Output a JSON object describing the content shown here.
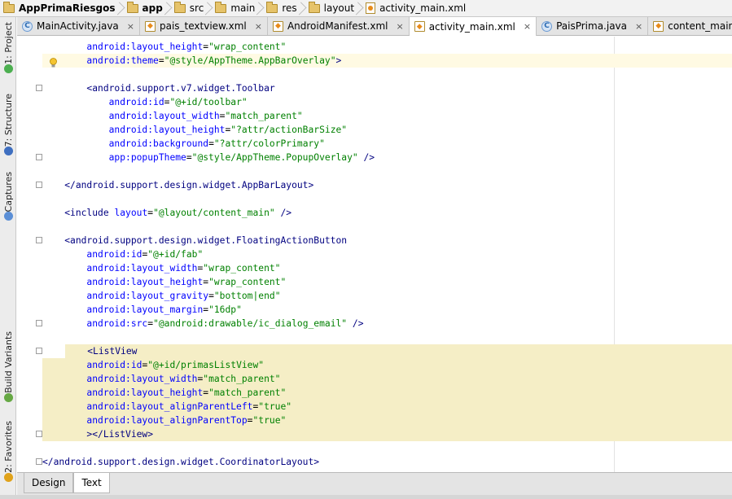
{
  "breadcrumb": [
    {
      "label": "AppPrimaRiesgos",
      "icon": "folder-icon",
      "bold": true
    },
    {
      "label": "app",
      "icon": "folder-icon",
      "bold": true
    },
    {
      "label": "src",
      "icon": "folder-icon",
      "bold": false
    },
    {
      "label": "main",
      "icon": "folder-icon",
      "bold": false
    },
    {
      "label": "res",
      "icon": "folder-icon",
      "bold": false
    },
    {
      "label": "layout",
      "icon": "folder-icon",
      "bold": false
    },
    {
      "label": "activity_main.xml",
      "icon": "xml-file-icon",
      "bold": false
    }
  ],
  "side_tools": [
    "1: Project",
    "7: Structure",
    "Captures",
    "Build Variants",
    "2: Favorites"
  ],
  "tabs": [
    {
      "label": "MainActivity.java",
      "type": "java",
      "active": false
    },
    {
      "label": "pais_textview.xml",
      "type": "xml",
      "active": false
    },
    {
      "label": "AndroidManifest.xml",
      "type": "xml",
      "active": false
    },
    {
      "label": "activity_main.xml",
      "type": "xml",
      "active": true
    },
    {
      "label": "PaisPrima.java",
      "type": "java",
      "active": false
    },
    {
      "label": "content_main.xml",
      "type": "xml",
      "active": false
    }
  ],
  "tab_close_glyph": "×",
  "code_lines": [
    {
      "indent": "        ",
      "segs": [
        [
          "attr",
          "android:layout_height"
        ],
        [
          "plain",
          "="
        ],
        [
          "val",
          "\"wrap_content\""
        ]
      ]
    },
    {
      "indent": "        ",
      "segs": [
        [
          "attr",
          "android:theme"
        ],
        [
          "plain",
          "="
        ],
        [
          "val",
          "\"@style/AppTheme.AppBarOverlay\""
        ],
        [
          "tag",
          ">"
        ]
      ],
      "cur": true,
      "bulb": true
    },
    {
      "indent": "",
      "segs": []
    },
    {
      "indent": "        ",
      "segs": [
        [
          "tag",
          "<android.support.v7.widget.Toolbar"
        ]
      ],
      "fold": true
    },
    {
      "indent": "            ",
      "segs": [
        [
          "attr",
          "android:id"
        ],
        [
          "plain",
          "="
        ],
        [
          "val",
          "\"@+id/toolbar\""
        ]
      ]
    },
    {
      "indent": "            ",
      "segs": [
        [
          "attr",
          "android:layout_width"
        ],
        [
          "plain",
          "="
        ],
        [
          "val",
          "\"match_parent\""
        ]
      ]
    },
    {
      "indent": "            ",
      "segs": [
        [
          "attr",
          "android:layout_height"
        ],
        [
          "plain",
          "="
        ],
        [
          "val",
          "\"?attr/actionBarSize\""
        ]
      ]
    },
    {
      "indent": "            ",
      "segs": [
        [
          "attr",
          "android:background"
        ],
        [
          "plain",
          "="
        ],
        [
          "val",
          "\"?attr/colorPrimary\""
        ]
      ]
    },
    {
      "indent": "            ",
      "segs": [
        [
          "attr",
          "app:popupTheme"
        ],
        [
          "plain",
          "="
        ],
        [
          "val",
          "\"@style/AppTheme.PopupOverlay\""
        ],
        [
          "tag",
          " />"
        ]
      ],
      "fold": true
    },
    {
      "indent": "",
      "segs": []
    },
    {
      "indent": "    ",
      "segs": [
        [
          "tag",
          "</android.support.design.widget.AppBarLayout>"
        ]
      ],
      "fold": true
    },
    {
      "indent": "",
      "segs": []
    },
    {
      "indent": "    ",
      "segs": [
        [
          "tag",
          "<include "
        ],
        [
          "attr",
          "layout"
        ],
        [
          "plain",
          "="
        ],
        [
          "val",
          "\"@layout/content_main\""
        ],
        [
          "tag",
          " />"
        ]
      ]
    },
    {
      "indent": "",
      "segs": []
    },
    {
      "indent": "    ",
      "segs": [
        [
          "tag",
          "<android.support.design.widget.FloatingActionButton"
        ]
      ],
      "fold": true
    },
    {
      "indent": "        ",
      "segs": [
        [
          "attr",
          "android:id"
        ],
        [
          "plain",
          "="
        ],
        [
          "val",
          "\"@+id/fab\""
        ]
      ]
    },
    {
      "indent": "        ",
      "segs": [
        [
          "attr",
          "android:layout_width"
        ],
        [
          "plain",
          "="
        ],
        [
          "val",
          "\"wrap_content\""
        ]
      ]
    },
    {
      "indent": "        ",
      "segs": [
        [
          "attr",
          "android:layout_height"
        ],
        [
          "plain",
          "="
        ],
        [
          "val",
          "\"wrap_content\""
        ]
      ]
    },
    {
      "indent": "        ",
      "segs": [
        [
          "attr",
          "android:layout_gravity"
        ],
        [
          "plain",
          "="
        ],
        [
          "val",
          "\"bottom|end\""
        ]
      ]
    },
    {
      "indent": "        ",
      "segs": [
        [
          "attr",
          "android:layout_margin"
        ],
        [
          "plain",
          "="
        ],
        [
          "val",
          "\"16dp\""
        ]
      ]
    },
    {
      "indent": "        ",
      "segs": [
        [
          "attr",
          "android:src"
        ],
        [
          "plain",
          "="
        ],
        [
          "val",
          "\"@android:drawable/ic_dialog_email\""
        ],
        [
          "tag",
          " />"
        ]
      ],
      "fold": true
    },
    {
      "indent": "",
      "segs": []
    },
    {
      "indent": "    ",
      "segs": [
        [
          "tag",
          "<ListView"
        ]
      ],
      "fold": true,
      "hl": true
    },
    {
      "indent": "        ",
      "segs": [
        [
          "attr",
          "android:id"
        ],
        [
          "plain",
          "="
        ],
        [
          "val",
          "\"@+id/primasListView\""
        ]
      ],
      "hl": true
    },
    {
      "indent": "        ",
      "segs": [
        [
          "attr",
          "android:layout_width"
        ],
        [
          "plain",
          "="
        ],
        [
          "val",
          "\"match_parent\""
        ]
      ],
      "hl": true
    },
    {
      "indent": "        ",
      "segs": [
        [
          "attr",
          "android:layout_height"
        ],
        [
          "plain",
          "="
        ],
        [
          "val",
          "\"match_parent\""
        ]
      ],
      "hl": true
    },
    {
      "indent": "        ",
      "segs": [
        [
          "attr",
          "android:layout_alignParentLeft"
        ],
        [
          "plain",
          "="
        ],
        [
          "val",
          "\"true\""
        ]
      ],
      "hl": true
    },
    {
      "indent": "        ",
      "segs": [
        [
          "attr",
          "android:layout_alignParentTop"
        ],
        [
          "plain",
          "="
        ],
        [
          "val",
          "\"true\""
        ]
      ],
      "hl": true
    },
    {
      "indent": "        ",
      "segs": [
        [
          "tag",
          "></ListView>"
        ]
      ],
      "fold": true,
      "hl": true
    },
    {
      "indent": "",
      "segs": []
    },
    {
      "indent": "",
      "segs": [
        [
          "tag",
          "</android.support.design.widget.CoordinatorLayout>"
        ]
      ],
      "fold": true
    }
  ],
  "bottom_tabs": [
    {
      "label": "Design",
      "active": false
    },
    {
      "label": "Text",
      "active": true
    }
  ],
  "colors": {
    "tag": "#000080",
    "attr": "#0000ff",
    "value": "#008000",
    "highlight": "#f5eec6",
    "current_line": "#fffae3"
  }
}
